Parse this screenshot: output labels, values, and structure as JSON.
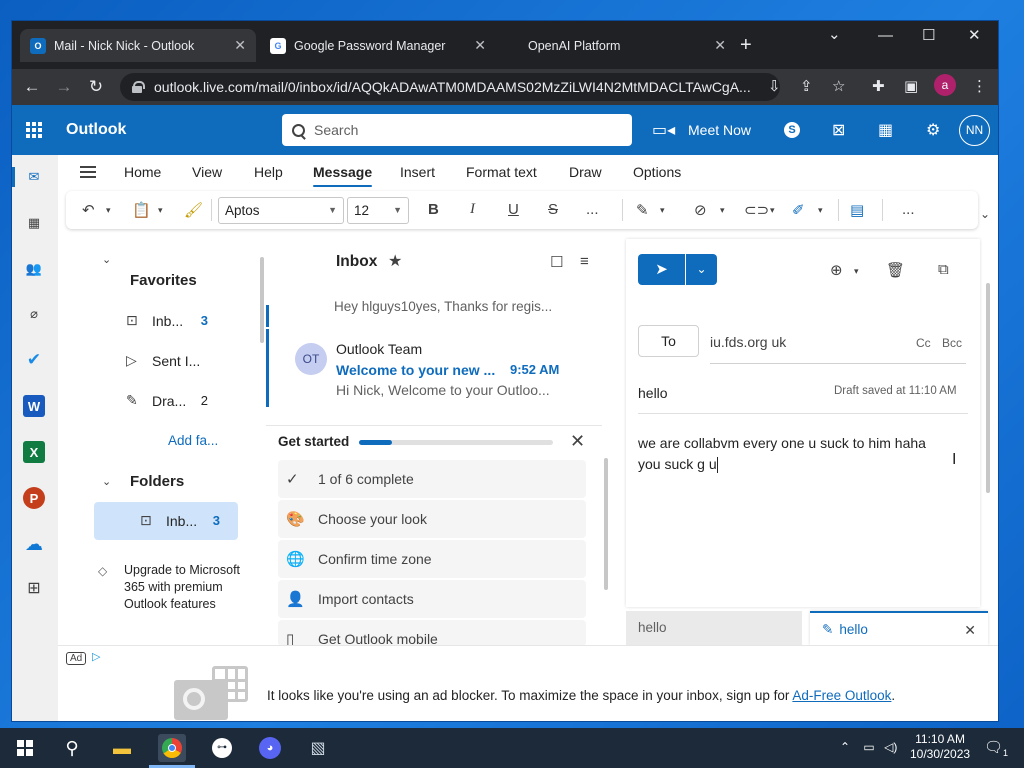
{
  "browser": {
    "tabs": [
      {
        "title": "Mail - Nick Nick - Outlook",
        "favicon": "outlook-favicon",
        "active": true
      },
      {
        "title": "Google Password Manager",
        "favicon": "google-favicon",
        "active": false
      },
      {
        "title": "OpenAI Platform",
        "favicon": "none",
        "active": false
      }
    ],
    "url": "outlook.live.com/mail/0/inbox/id/AQQkADAwATM0MDAAMS02MzZiLWI4N2MtMDACLTAwCgA...",
    "profile_initial": "a"
  },
  "outlook": {
    "brand": "Outlook",
    "search_placeholder": "Search",
    "meet_now": "Meet Now",
    "user_initials": "NN",
    "ribbon_tabs": [
      "Home",
      "View",
      "Help",
      "Message",
      "Insert",
      "Format text",
      "Draw",
      "Options"
    ],
    "active_ribbon_tab": "Message",
    "font_name": "Aptos",
    "font_size": "12",
    "overflow": "..."
  },
  "folders": {
    "favorites_heading": "Favorites",
    "favorites": [
      {
        "label": "Inb...",
        "count": "3",
        "icon": "inbox-icon"
      },
      {
        "label": "Sent I...",
        "count": "",
        "icon": "send-icon"
      },
      {
        "label": "Dra...",
        "count": "2",
        "icon": "pencil-icon"
      }
    ],
    "add_favorite": "Add fa...",
    "folders_heading": "Folders",
    "folder_items": [
      {
        "label": "Inb...",
        "count": "3",
        "icon": "inbox-icon"
      }
    ],
    "upgrade_text": "Upgrade to Microsoft 365 with premium Outlook features"
  },
  "message_list": {
    "title": "Inbox",
    "cut_preview": "Hey hlguys10yes, Thanks for regis...",
    "emails": [
      {
        "initials": "OT",
        "sender": "Outlook Team",
        "subject": "Welcome to your new ...",
        "time": "9:52 AM",
        "preview": "Hi Nick, Welcome to your Outloo..."
      }
    ],
    "get_started": {
      "title": "Get started",
      "progress": 0.17,
      "items": [
        {
          "label": "1 of 6 complete",
          "icon": "check-icon"
        },
        {
          "label": "Choose your look",
          "icon": "palette-icon"
        },
        {
          "label": "Confirm time zone",
          "icon": "globe-icon"
        },
        {
          "label": "Import contacts",
          "icon": "contacts-icon"
        },
        {
          "label": "Get Outlook mobile",
          "icon": "phone-icon"
        }
      ]
    }
  },
  "compose": {
    "to_label": "To",
    "to_value": "iu.fds.org uk",
    "cc": "Cc",
    "bcc": "Bcc",
    "subject": "hello",
    "draft_saved": "Draft saved at 11:10 AM",
    "body_line1": "we are collabvm every one u suck to him haha",
    "body_line2": "you suck g u"
  },
  "compose_tabs": [
    {
      "label": "hello",
      "active": false
    },
    {
      "label": "hello",
      "active": true
    }
  ],
  "ad": {
    "tag": "Ad",
    "message": "It looks like you're using an ad blocker. To maximize the space in your inbox, sign up for ",
    "link": "Ad-Free Outlook",
    "suffix": "."
  },
  "taskbar": {
    "time": "11:10 AM",
    "date": "10/30/2023",
    "notifications": "1"
  },
  "colors": {
    "outlook_blue": "#0f6cbd",
    "chrome_dark": "#202124",
    "taskbar": "#1c2a3a"
  }
}
